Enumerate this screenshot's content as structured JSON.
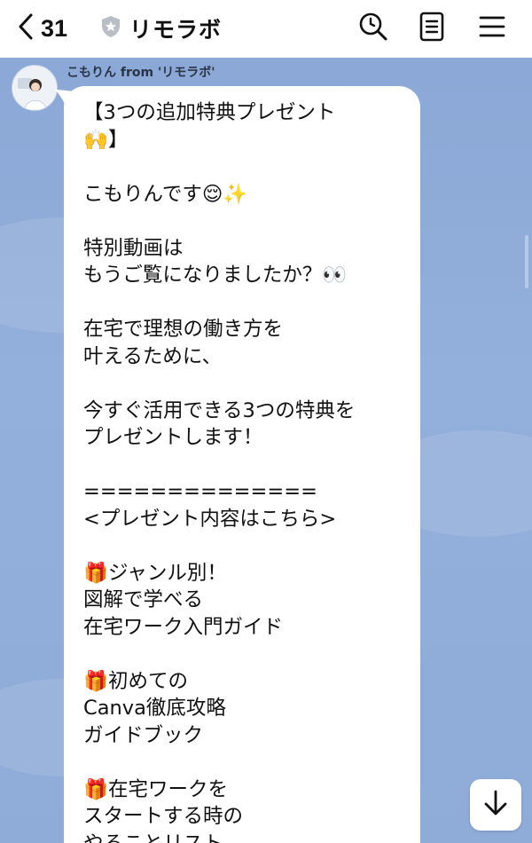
{
  "header": {
    "back_count": "31",
    "title": "リモラボ",
    "icons": [
      "back-chevron-icon",
      "shield-icon",
      "search-icon",
      "notes-icon",
      "menu-icon"
    ]
  },
  "chat": {
    "sender": "こもりん from 'リモラボ'",
    "message_lines": [
      "【3つの追加特典プレゼント",
      "🙌】",
      "",
      "こもりんです😌✨",
      "",
      "特別動画は",
      "もうご覧になりましたか？👀",
      "",
      "在宅で理想の働き方を",
      "叶えるために、",
      "",
      "今すぐ活用できる3つの特典を",
      "プレゼントします！",
      "",
      "==============",
      "<プレゼント内容はこちら>",
      "",
      "🎁ジャンル別！",
      "図解で学べる",
      "在宅ワーク入門ガイド",
      "",
      "🎁初めての",
      "Canva徹底攻略",
      "ガイドブック",
      "",
      "🎁在宅ワークを",
      "スタートする時の",
      "やることリスト"
    ]
  },
  "colors": {
    "chat_background": "#8fabd8",
    "bubble": "#ffffff",
    "header": "#ffffff"
  }
}
